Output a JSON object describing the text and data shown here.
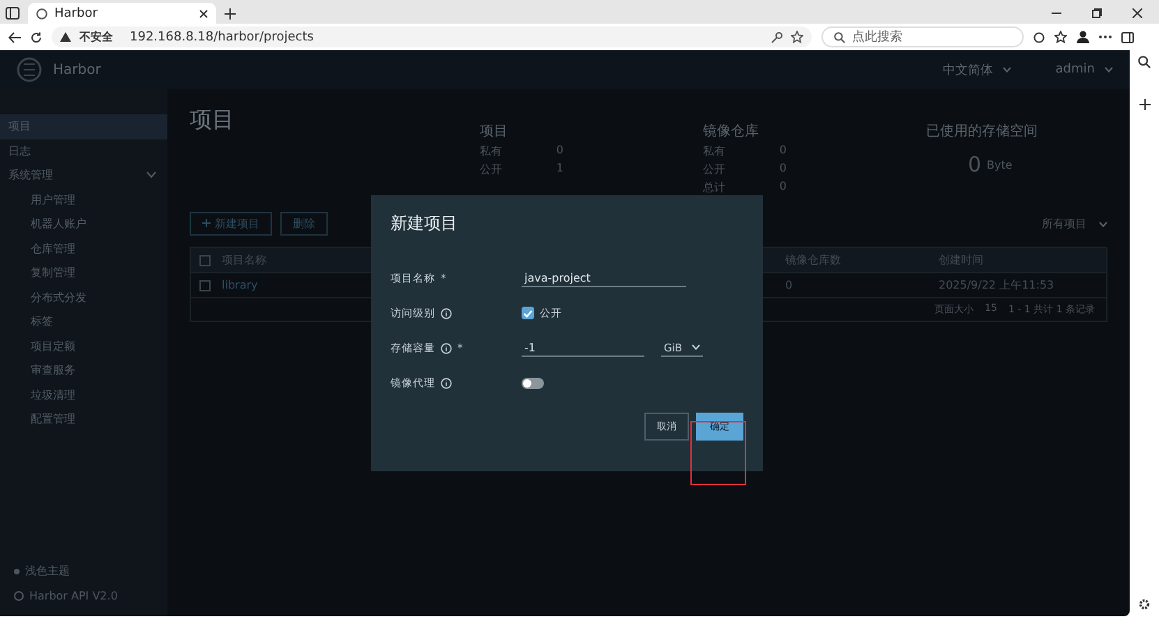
{
  "browser": {
    "tab_title": "Harbor",
    "security_label": "不安全",
    "url": "192.168.8.18/harbor/projects",
    "search_placeholder": "点此搜索"
  },
  "app": {
    "brand": "Harbor",
    "language": "中文简体",
    "user": "admin"
  },
  "sidebar": {
    "items": [
      {
        "label": "项目",
        "selected": true
      },
      {
        "label": "日志",
        "selected": false
      },
      {
        "label": "系统管理",
        "selected": false,
        "expanded": true,
        "children": [
          {
            "label": "用户管理",
            "selected": false
          },
          {
            "label": "机器人账户",
            "selected": false
          },
          {
            "label": "仓库管理",
            "selected": false
          },
          {
            "label": "复制管理",
            "selected": false
          },
          {
            "label": "分布式分发",
            "selected": false
          },
          {
            "label": "标签",
            "selected": false
          },
          {
            "label": "项目定额",
            "selected": false
          },
          {
            "label": "审查服务",
            "selected": false
          },
          {
            "label": "垃圾清理",
            "selected": false
          },
          {
            "label": "配置管理",
            "selected": false
          }
        ]
      }
    ],
    "footer": [
      "浅色主题",
      "Harbor API V2.0"
    ]
  },
  "page_title": "项目",
  "stats": [
    {
      "title": "项目",
      "rows": [
        {
          "label": "私有",
          "value": "0"
        },
        {
          "label": "公开",
          "value": "1"
        }
      ]
    },
    {
      "title": "镜像仓库",
      "rows": [
        {
          "label": "私有",
          "value": "0"
        },
        {
          "label": "公开",
          "value": "0"
        },
        {
          "label": "总计",
          "value": "0"
        }
      ]
    }
  ],
  "storage": {
    "title": "已使用的存储空间",
    "value": "0",
    "unit": "Byte"
  },
  "toolbar": {
    "new_button": "新建项目",
    "delete_button": "删除",
    "filter": "所有项目"
  },
  "table": {
    "all_selected": false,
    "columns": [
      "项目名称",
      "镜像仓库数",
      "创建时间"
    ],
    "rows": [
      {
        "cells": [
          "library",
          "0",
          "2025/9/22 上午11:53"
        ],
        "selected": false
      }
    ]
  },
  "pagination": {
    "label": "页面大小",
    "size": "15",
    "summary": "1 - 1 共计 1 条记录"
  },
  "modal": {
    "title": "新建项目",
    "fields": [
      {
        "kind": "text",
        "label": "项目名称",
        "required_mark": "*",
        "info": false,
        "value": "java-project"
      },
      {
        "kind": "checkbox",
        "label": "访问级别",
        "info": true,
        "checked": true,
        "option": "公开"
      },
      {
        "kind": "quota",
        "label": "存储容量",
        "required_mark": "*",
        "info": true,
        "value": "-1",
        "unit": "GiB"
      },
      {
        "kind": "toggle",
        "label": "镜像代理",
        "info": true,
        "on": false
      }
    ],
    "cancel": "取消",
    "confirm": "确定",
    "confirm_highlighted": true
  }
}
